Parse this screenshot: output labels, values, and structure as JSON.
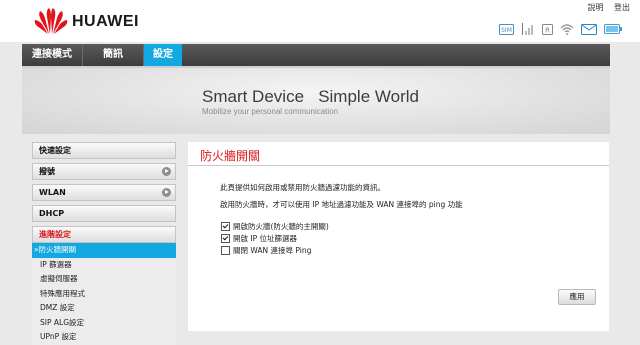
{
  "header": {
    "brand": "HUAWEI",
    "links": {
      "help": "說明",
      "logout": "登出"
    },
    "status_icons": [
      "sim-icon",
      "signal-icon",
      "network-mode-icon",
      "wifi-icon",
      "sms-icon",
      "battery-icon"
    ]
  },
  "nav": {
    "tabs": [
      {
        "label": "連接模式",
        "active": false
      },
      {
        "label": "簡訊",
        "active": false
      },
      {
        "label": "設定",
        "active": true
      }
    ]
  },
  "banner": {
    "title": "Smart Device   Simple World",
    "subtitle": "Mobilize your personal communication"
  },
  "sidebar": {
    "sections": [
      {
        "label": "快速設定"
      },
      {
        "label": "撥號"
      },
      {
        "label": "WLAN"
      },
      {
        "label": "DHCP"
      },
      {
        "label": "進階設定"
      }
    ],
    "subitems": [
      {
        "label": "»防火牆開關",
        "active": true
      },
      {
        "label": "IP 篩選器"
      },
      {
        "label": "虛擬伺服器"
      },
      {
        "label": "特殊應用程式"
      },
      {
        "label": "DMZ 設定"
      },
      {
        "label": "SIP ALG設定"
      },
      {
        "label": "UPnP 設定"
      }
    ]
  },
  "main": {
    "title": "防火牆開關",
    "desc1": "此頁提供如何啟用或禁用防火牆過濾功能的資訊。",
    "desc2": "啟用防火牆時，才可以使用 IP 地址過濾功能及 WAN 連接埠的 ping 功能",
    "options": [
      {
        "label": "開啟防火牆(防火牆的主開關)",
        "checked": true
      },
      {
        "label": "開啟 IP 位址篩選器",
        "checked": true
      },
      {
        "label": "關閉 WAN 連接埠 Ping",
        "checked": false
      }
    ],
    "apply": "應用"
  },
  "colors": {
    "accent": "#14a8e0",
    "title_red": "#d7191d",
    "nav_bg": "#4a4a4a"
  }
}
